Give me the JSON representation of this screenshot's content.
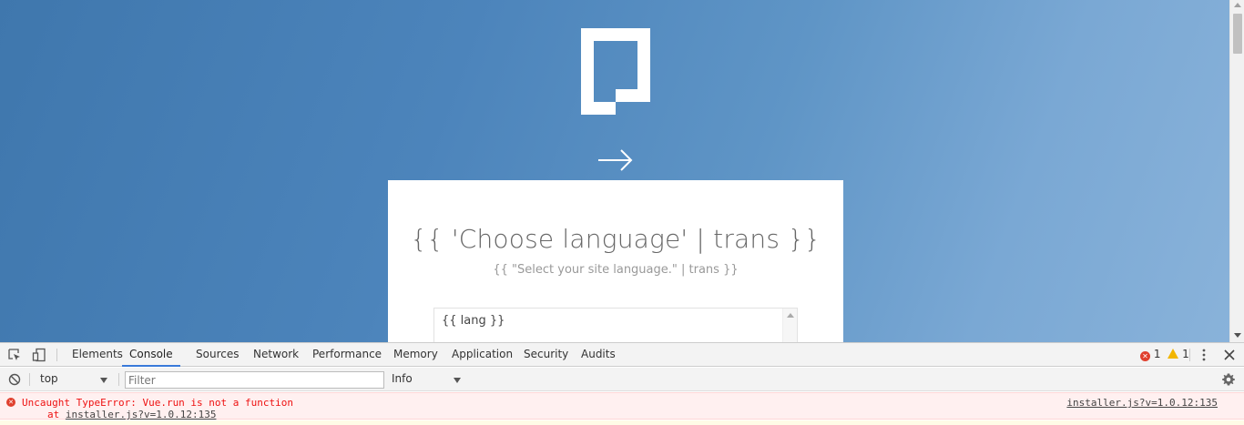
{
  "page": {
    "card_title": "{{ 'Choose language' | trans }}",
    "card_subtitle": "{{ \"Select your site language.\" | trans }}",
    "lang_select_value": "{{ lang }}",
    "logo_icon": "pagekit-logo-icon",
    "next_icon": "arrow-right-icon",
    "background_color": "#4c84bb"
  },
  "devtools": {
    "tabs": [
      {
        "label": "Elements"
      },
      {
        "label": "Console",
        "active": true
      },
      {
        "label": "Sources"
      },
      {
        "label": "Network"
      },
      {
        "label": "Performance"
      },
      {
        "label": "Memory"
      },
      {
        "label": "Application"
      },
      {
        "label": "Security"
      },
      {
        "label": "Audits"
      }
    ],
    "error_count": "1",
    "warning_count": "1",
    "context": "top",
    "filter_placeholder": "Filter",
    "level": "Info",
    "accent_color": "#3879d9",
    "error_color": "#e0402e"
  },
  "console": {
    "error_message": "Uncaught TypeError: Vue.run is not a function",
    "error_at_prefix": "at ",
    "error_at_link": "installer.js?v=1.0.12:135",
    "error_source": "installer.js?v=1.0.12:135"
  }
}
